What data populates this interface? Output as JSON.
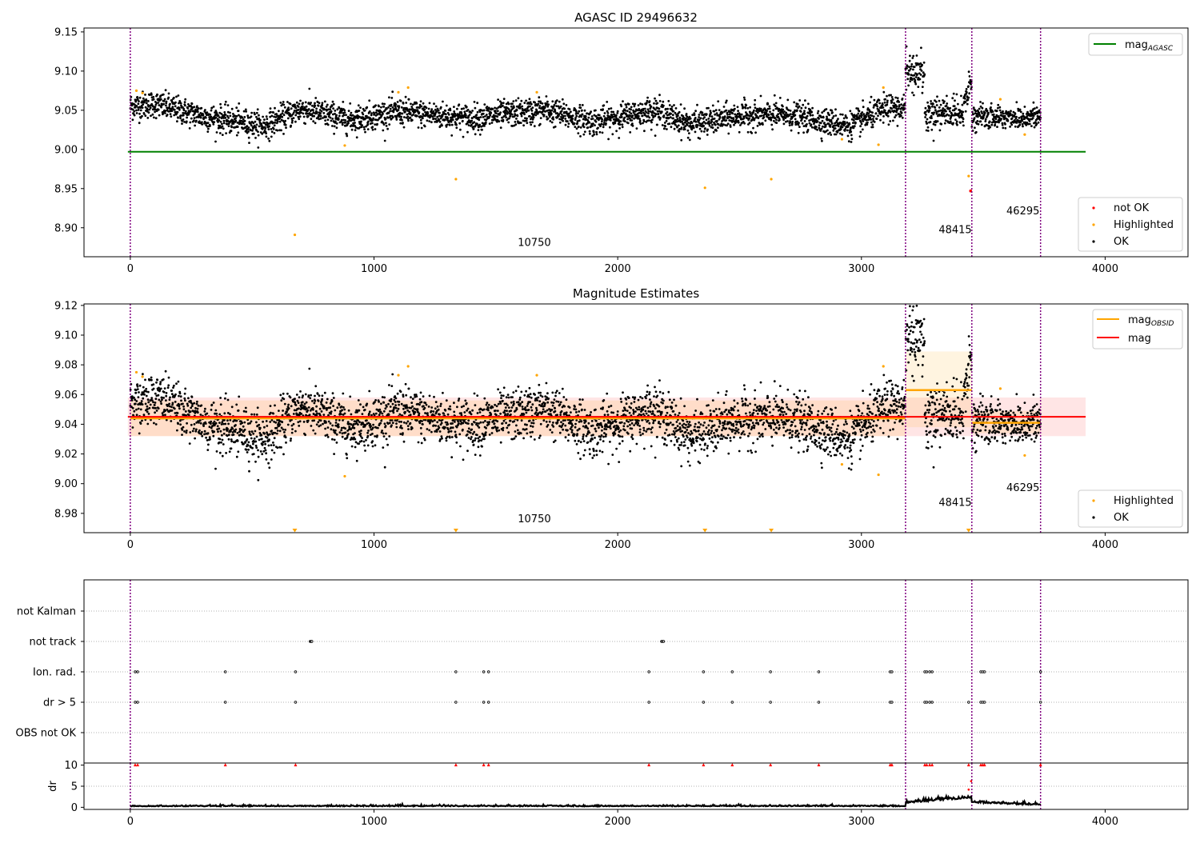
{
  "figure": {
    "x_ticks": [
      0,
      1000,
      2000,
      3000,
      4000
    ],
    "x_range": [
      -190,
      4340
    ],
    "intervals": [
      {
        "start": 0,
        "end": 3181,
        "obsid": "10750",
        "mean": 9.044
      },
      {
        "start": 3181,
        "end": 3453,
        "obsid": "48415",
        "mean": 9.063
      },
      {
        "start": 3453,
        "end": 3735,
        "obsid": "46295",
        "mean": 9.041
      }
    ]
  },
  "colors": {
    "ok": "#000000",
    "highlighted": "#ffa500",
    "not_ok": "#ff0000",
    "agasc_line": "#008000",
    "mag_line": "#ff0000",
    "obs_line": "#ffa500",
    "boundary": "#800080"
  },
  "chart_data": [
    {
      "type": "scatter",
      "title": "AGASC ID 29496632",
      "xlabel": "",
      "ylabel": "",
      "xlim": [
        -190,
        4340
      ],
      "ylim": [
        8.863,
        9.155
      ],
      "y_ticks": [
        "9.15",
        "9.10",
        "9.05",
        "9.00",
        "8.95",
        "8.90"
      ],
      "grid": false,
      "legend_top": {
        "position": "upper right",
        "entries": [
          {
            "label": "mag",
            "sub": "AGASC"
          }
        ]
      },
      "legend_bottom": {
        "position": "lower right",
        "entries": [
          "not OK",
          "Highlighted",
          "OK"
        ]
      },
      "lines": [
        {
          "name": "mag_AGASC",
          "y": 8.997,
          "x_range": [
            -10,
            3920
          ]
        }
      ],
      "series": [
        {
          "name": "OK",
          "description": "dense time series of ~3700 points",
          "level": [
            [
              0,
              9.055
            ],
            [
              100,
              9.058
            ],
            [
              300,
              9.042
            ],
            [
              550,
              9.03
            ],
            [
              700,
              9.052
            ],
            [
              900,
              9.038
            ],
            [
              1100,
              9.048
            ],
            [
              1200,
              9.045
            ],
            [
              1400,
              9.04
            ],
            [
              1700,
              9.05
            ],
            [
              1900,
              9.035
            ],
            [
              2150,
              9.05
            ],
            [
              2300,
              9.032
            ],
            [
              2500,
              9.043
            ],
            [
              2700,
              9.044
            ],
            [
              2950,
              9.03
            ],
            [
              3100,
              9.052
            ],
            [
              3180,
              9.052
            ]
          ]
        },
        {
          "name": "Highlighted",
          "points": [
            [
              25,
              9.075
            ],
            [
              50,
              9.072
            ],
            [
              675,
              8.891
            ],
            [
              880,
              9.005
            ],
            [
              1100,
              9.073
            ],
            [
              1140,
              9.079
            ],
            [
              1336,
              8.962
            ],
            [
              1668,
              9.073
            ],
            [
              2358,
              8.951
            ],
            [
              2630,
              8.962
            ],
            [
              2920,
              9.013
            ],
            [
              3070,
              9.006
            ],
            [
              3090,
              9.079
            ],
            [
              3440,
              8.966
            ],
            [
              3570,
              9.064
            ],
            [
              3670,
              9.019
            ]
          ]
        },
        {
          "name": "not OK",
          "points": [
            [
              3448,
              8.947
            ]
          ]
        }
      ],
      "annotations": [
        {
          "text": "10750",
          "x": 1590,
          "y": 8.877
        },
        {
          "text": "48415",
          "x": 3317,
          "y": 8.893
        },
        {
          "text": "46295",
          "x": 3595,
          "y": 8.917
        }
      ]
    },
    {
      "type": "scatter",
      "title": "Magnitude Estimates",
      "xlabel": "",
      "ylabel": "",
      "xlim": [
        -190,
        4340
      ],
      "ylim": [
        8.967,
        9.121
      ],
      "y_ticks": [
        "9.12",
        "9.10",
        "9.08",
        "9.06",
        "9.04",
        "9.02",
        "9.00",
        "8.98"
      ],
      "grid": false,
      "legend_top": {
        "position": "upper right",
        "entries": [
          {
            "label": "mag",
            "sub": "OBSID"
          },
          {
            "label": "mag",
            "sub": ""
          }
        ]
      },
      "legend_bottom": {
        "position": "lower right",
        "entries": [
          "Highlighted",
          "OK"
        ]
      },
      "lines": [
        {
          "name": "mag",
          "y": 9.045,
          "band": [
            9.032,
            9.058
          ],
          "x_range": [
            -10,
            3920
          ]
        }
      ],
      "obsid_bands": [
        [
          0.003,
          9.032,
          9.056
        ],
        [
          0,
          9.038,
          9.089
        ],
        [
          0,
          9.034,
          9.049
        ]
      ],
      "annotations": [
        {
          "text": "10750",
          "x": 1590,
          "y": 8.974
        },
        {
          "text": "48415",
          "x": 3317,
          "y": 8.985
        },
        {
          "text": "46295",
          "x": 3595,
          "y": 8.995
        }
      ],
      "clipped_markers": [
        675,
        1336,
        2358,
        2630,
        3440
      ]
    },
    {
      "type": "scatter",
      "title": "",
      "xlabel": "",
      "ylabel": "",
      "categories": [
        "not Kalman",
        "not track",
        "Ion. rad.",
        "dr > 5",
        "OBS not OK"
      ],
      "grid": true,
      "flag_times": {
        "not track": [
          738,
          742,
          745,
          2180,
          2184,
          2188
        ],
        "Ion. rad.": [
          20,
          30,
          390,
          678,
          1336,
          1450,
          1470,
          2128,
          2352,
          2470,
          2627,
          2825,
          3118,
          3125,
          3260,
          3268,
          3280,
          3290,
          3490,
          3498,
          3505,
          3735
        ],
        "dr > 5": [
          20,
          30,
          390,
          678,
          1336,
          1450,
          1470,
          2128,
          2352,
          2470,
          2627,
          2825,
          3118,
          3125,
          3260,
          3268,
          3280,
          3290,
          3440,
          3490,
          3498,
          3505,
          3735
        ]
      }
    },
    {
      "type": "line",
      "title": "",
      "xlabel": "",
      "ylabel": "dr",
      "xlim": [
        -190,
        4340
      ],
      "ylim": [
        -0.5,
        10.5
      ],
      "y_ticks": [
        "10",
        "5",
        "0"
      ],
      "clip_markers_y": 10,
      "segments": [
        {
          "x": [
            0,
            3181
          ],
          "level": 0.25
        },
        {
          "x": [
            3181,
            3453
          ],
          "level": 2.0
        },
        {
          "x": [
            3453,
            3735
          ],
          "level": 0.9
        }
      ]
    }
  ]
}
